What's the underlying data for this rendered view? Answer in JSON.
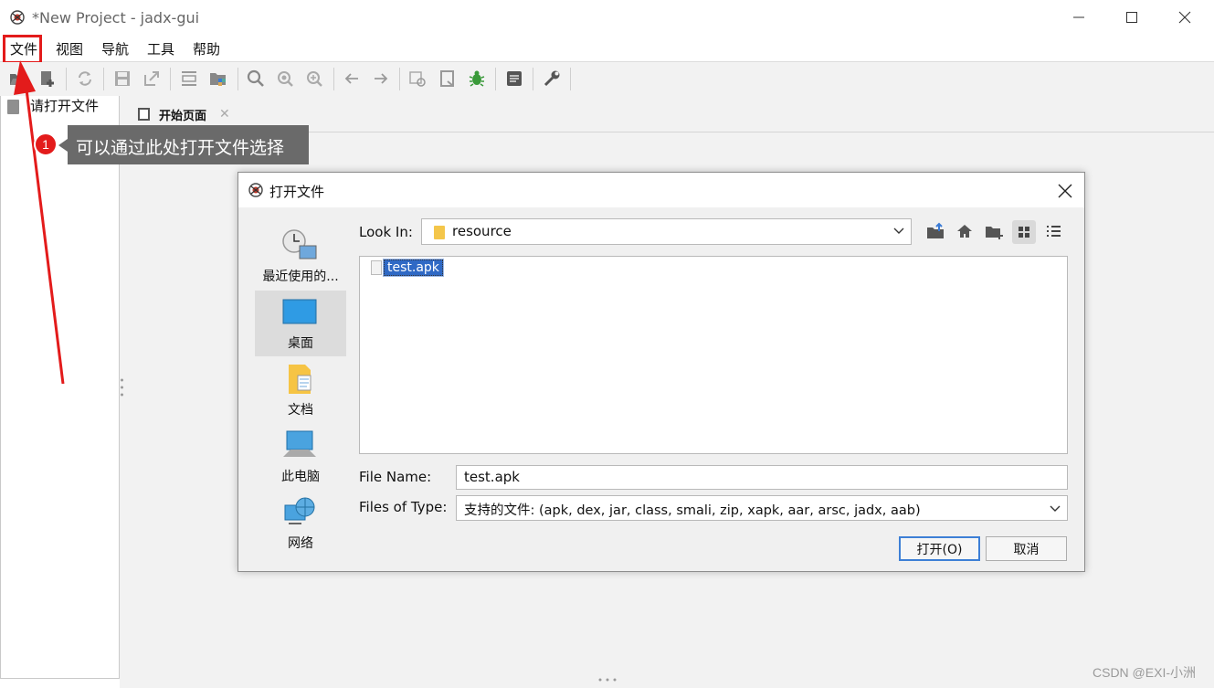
{
  "window": {
    "title": "*New Project - jadx-gui",
    "minimize": "—",
    "maximize": "☐",
    "close": "✕"
  },
  "menu": {
    "items": [
      "文件",
      "视图",
      "导航",
      "工具",
      "帮助"
    ]
  },
  "toolbar": {
    "icons": [
      "open-icon",
      "add-file-icon",
      "sync-icon",
      "save-icon",
      "export-icon",
      "expand-icon",
      "package-icon",
      "search-icon",
      "search-class-icon",
      "search-usage-icon",
      "back-icon",
      "forward-icon",
      "deobf-icon",
      "decompile-icon",
      "debug-icon",
      "log-icon",
      "settings-icon"
    ]
  },
  "left_panel": {
    "label": "请打开文件"
  },
  "tab": {
    "label": "开始页面",
    "close": "✕"
  },
  "annotation": {
    "number": "1",
    "text": "可以通过此处打开文件选择",
    "color": "#e31b1b"
  },
  "dialog": {
    "title": "打开文件",
    "close": "✕",
    "look_in_label": "Look In:",
    "look_in_value": "resource",
    "combo_arrow": "⌵",
    "places": [
      {
        "label": "最近使用的...",
        "icon": "recent-icon"
      },
      {
        "label": "桌面",
        "icon": "desktop-icon"
      },
      {
        "label": "文档",
        "icon": "documents-icon"
      },
      {
        "label": "此电脑",
        "icon": "computer-icon"
      },
      {
        "label": "网络",
        "icon": "network-icon"
      }
    ],
    "files": [
      "test.apk"
    ],
    "file_name_label": "File Name:",
    "file_name_value": "test.apk",
    "file_type_label": "Files of Type:",
    "file_type_value": "支持的文件: (apk, dex, jar, class, smali, zip, xapk, aar, arsc, jadx, aab)",
    "open_button": "打开(O)",
    "cancel_button": "取消"
  },
  "watermark": "CSDN @EXI-小洲"
}
